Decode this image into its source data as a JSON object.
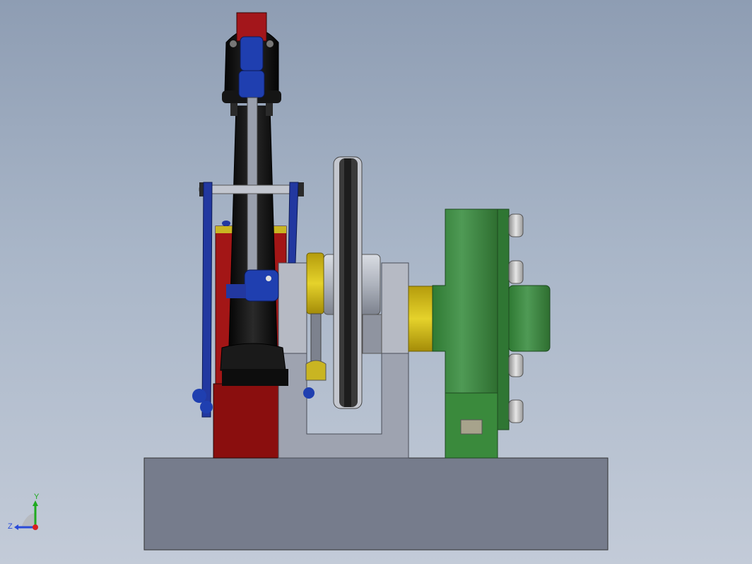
{
  "view": {
    "background_top": "#8e9db3",
    "background_bottom": "#c3cbd8"
  },
  "model": {
    "parts": [
      {
        "name": "base-plate",
        "color": "#767c8c"
      },
      {
        "name": "cylinder-column",
        "color": "#111111"
      },
      {
        "name": "cylinder-head-cap",
        "color": "#a3161b"
      },
      {
        "name": "piston-clevis",
        "color": "#1f3fb0"
      },
      {
        "name": "connecting-rod",
        "color": "#9aa0ad"
      },
      {
        "name": "valve-linkage",
        "color": "#2238a0"
      },
      {
        "name": "red-cylinder-body",
        "color": "#a01414"
      },
      {
        "name": "red-foot-block",
        "color": "#8a0d0d"
      },
      {
        "name": "bearing-bracket",
        "color": "#9ea3b0"
      },
      {
        "name": "flywheel",
        "color": "#2f2f2f"
      },
      {
        "name": "yellow-collar",
        "color": "#d8c21a"
      },
      {
        "name": "green-generator",
        "color": "#3d8b3d"
      },
      {
        "name": "generator-bolts",
        "color": "#c8c8c8"
      }
    ]
  },
  "triad": {
    "y_label": "Y",
    "z_label": "Z",
    "y_color": "#1faa1f",
    "z_color": "#2a4bd8",
    "x_color": "#d81f1f"
  }
}
